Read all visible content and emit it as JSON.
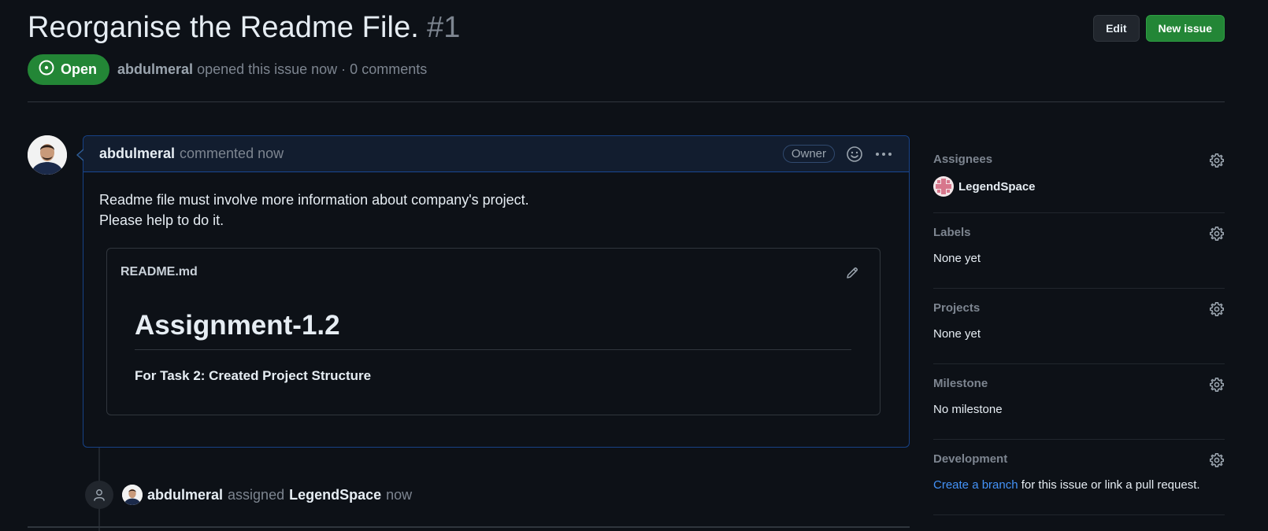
{
  "issue": {
    "title": "Reorganise the Readme File.",
    "number": "#1",
    "state": "Open",
    "author": "abdulmeral",
    "meta_text": "opened this issue now · 0 comments"
  },
  "header_buttons": {
    "edit_label": "Edit",
    "new_issue_label": "New issue"
  },
  "comment": {
    "author": "abdulmeral",
    "time": "commented now",
    "role_badge": "Owner",
    "body_line1": "Readme file must involve more information about company's project.",
    "body_line2": "Please help to do it.",
    "readme": {
      "filename": "README.md",
      "heading": "Assignment-1.2",
      "text": "For Task 2: Created Project Structure"
    }
  },
  "event": {
    "actor": "abdulmeral",
    "action": "assigned",
    "target": "LegendSpace",
    "time": "now"
  },
  "sidebar": {
    "assignees": {
      "label": "Assignees",
      "user": "LegendSpace"
    },
    "labels": {
      "label": "Labels",
      "value": "None yet"
    },
    "projects": {
      "label": "Projects",
      "value": "None yet"
    },
    "milestone": {
      "label": "Milestone",
      "value": "No milestone"
    },
    "development": {
      "label": "Development",
      "link_text": "Create a branch",
      "rest_text": "for this issue or link a pull request."
    }
  },
  "colors": {
    "background": "#0d1117",
    "open_green": "#238636",
    "link_blue": "#4493f8",
    "muted": "#7d8590",
    "comment_header": "#121d2f"
  },
  "icons": [
    "issue-opened-icon",
    "smiley-icon",
    "kebab-horizontal-icon",
    "pencil-icon",
    "gear-icon",
    "person-icon"
  ]
}
